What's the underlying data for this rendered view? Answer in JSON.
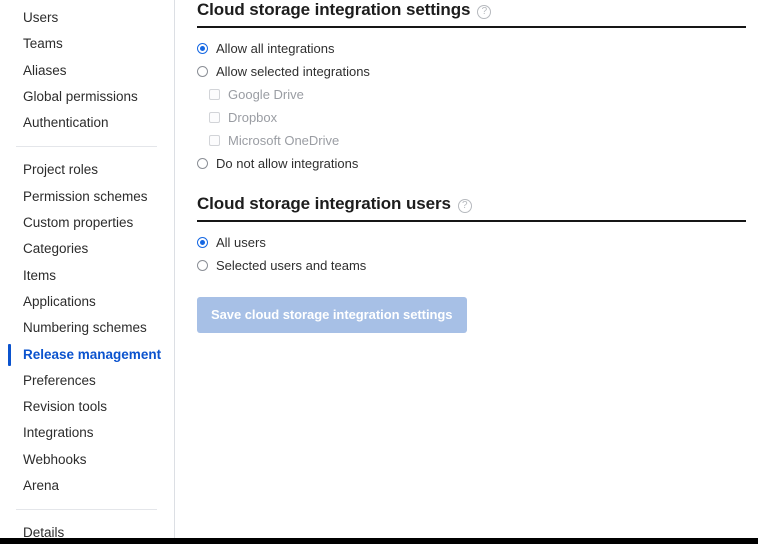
{
  "sidebar": {
    "groups": [
      {
        "items": [
          {
            "label": "Users",
            "active": false
          },
          {
            "label": "Teams",
            "active": false
          },
          {
            "label": "Aliases",
            "active": false
          },
          {
            "label": "Global permissions",
            "active": false
          },
          {
            "label": "Authentication",
            "active": false
          }
        ]
      },
      {
        "items": [
          {
            "label": "Project roles",
            "active": false
          },
          {
            "label": "Permission schemes",
            "active": false
          },
          {
            "label": "Custom properties",
            "active": false
          },
          {
            "label": "Categories",
            "active": false
          },
          {
            "label": "Items",
            "active": false
          },
          {
            "label": "Applications",
            "active": false
          },
          {
            "label": "Numbering schemes",
            "active": false
          },
          {
            "label": "Release management",
            "active": true
          },
          {
            "label": "Preferences",
            "active": false
          },
          {
            "label": "Revision tools",
            "active": false
          },
          {
            "label": "Integrations",
            "active": false
          },
          {
            "label": "Webhooks",
            "active": false
          },
          {
            "label": "Arena",
            "active": false
          }
        ]
      },
      {
        "items": [
          {
            "label": "Details",
            "active": false
          }
        ]
      }
    ]
  },
  "main": {
    "settings_section": {
      "title": "Cloud storage integration settings",
      "help_icon": "?",
      "options": [
        {
          "label": "Allow all integrations",
          "type": "radio",
          "checked": true,
          "disabled": false,
          "indent": false
        },
        {
          "label": "Allow selected integrations",
          "type": "radio",
          "checked": false,
          "disabled": false,
          "indent": false
        },
        {
          "label": "Google Drive",
          "type": "checkbox",
          "checked": false,
          "disabled": true,
          "indent": true
        },
        {
          "label": "Dropbox",
          "type": "checkbox",
          "checked": false,
          "disabled": true,
          "indent": true
        },
        {
          "label": "Microsoft OneDrive",
          "type": "checkbox",
          "checked": false,
          "disabled": true,
          "indent": true
        },
        {
          "label": "Do not allow integrations",
          "type": "radio",
          "checked": false,
          "disabled": false,
          "indent": false
        }
      ]
    },
    "users_section": {
      "title": "Cloud storage integration users",
      "help_icon": "?",
      "options": [
        {
          "label": "All users",
          "type": "radio",
          "checked": true,
          "disabled": false,
          "indent": false
        },
        {
          "label": "Selected users and teams",
          "type": "radio",
          "checked": false,
          "disabled": false,
          "indent": false
        }
      ]
    },
    "save_button": {
      "label": "Save cloud storage integration settings",
      "disabled": true
    }
  },
  "colors": {
    "accent": "#0b53ce",
    "radio_checked": "#1668e3",
    "rule": "#161616",
    "save_disabled_bg": "#a7c0e6",
    "sidebar_border": "#dcdfe4",
    "bottom_bar": "#000000"
  }
}
